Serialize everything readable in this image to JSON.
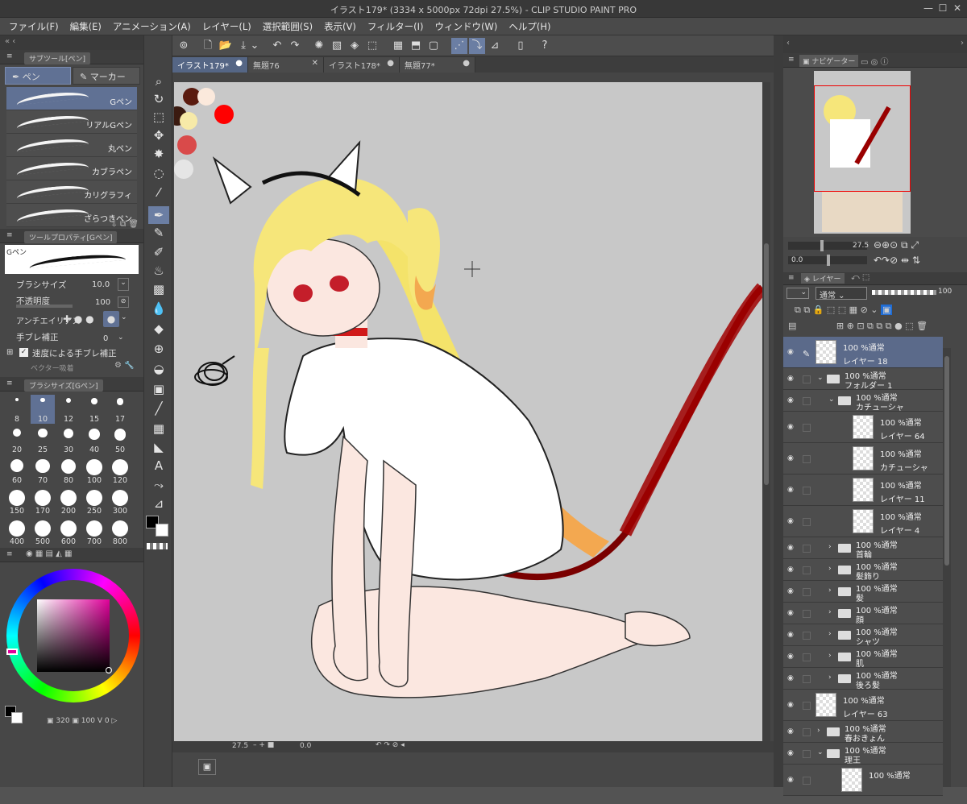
{
  "window": {
    "title": "イラスト179* (3334 x 5000px 72dpi 27.5%)  - CLIP STUDIO PAINT PRO"
  },
  "menu": [
    "ファイル(F)",
    "編集(E)",
    "アニメーション(A)",
    "レイヤー(L)",
    "選択範囲(S)",
    "表示(V)",
    "フィルター(I)",
    "ウィンドウ(W)",
    "ヘルプ(H)"
  ],
  "subtool": {
    "panel_label": "サブツール[ペン]",
    "groups": [
      "ペン",
      "マーカー"
    ],
    "brushes": [
      "Gペン",
      "リアルGペン",
      "丸ペン",
      "カブラペン",
      "カリグラフィ",
      "ざらつきペン"
    ]
  },
  "toolprop": {
    "panel_label": "ツールプロパティ[Gペン]",
    "preview_name": "Gペン",
    "brush_size_label": "ブラシサイズ",
    "brush_size": "10.0",
    "opacity_label": "不透明度",
    "opacity": "100",
    "antialias_label": "アンチエイリアス",
    "stabilize_label": "手ブレ補正",
    "stabilize": "0",
    "speed_label": "速度による手ブレ補正",
    "vector_label": "ベクター吸着"
  },
  "brushsize": {
    "panel_label": "ブラシサイズ[Gペン]",
    "sizes": [
      "8",
      "10",
      "12",
      "15",
      "17",
      "20",
      "25",
      "30",
      "40",
      "50",
      "60",
      "70",
      "80",
      "100",
      "120",
      "150",
      "170",
      "200",
      "250",
      "300",
      "400",
      "500",
      "600",
      "700",
      "800"
    ]
  },
  "color": {
    "readout_a": "320",
    "readout_b": "100",
    "readout_c": "V",
    "readout_d": "0"
  },
  "tabs": [
    {
      "label": "イラスト179*",
      "active": true
    },
    {
      "label": "無題76",
      "active": false
    },
    {
      "label": "イラスト178*",
      "active": false
    },
    {
      "label": "無題77*",
      "active": false
    }
  ],
  "status": {
    "zoom": "27.5",
    "angle": "0.0"
  },
  "navigator": {
    "label": "ナビゲーター",
    "zoom": "27.5",
    "angle": "0.0"
  },
  "layers": {
    "tab_label": "レイヤー",
    "blend_mode": "通常",
    "opacity": "100",
    "rows": [
      {
        "top": "100 %通常",
        "name": "レイヤー 18",
        "kind": "layer",
        "depth": 0,
        "sel": true
      },
      {
        "top": "100 %通常",
        "name": "フォルダー 1",
        "kind": "folder-open",
        "depth": 0,
        "sel": false
      },
      {
        "top": "100 %通常",
        "name": "カチューシャ",
        "kind": "folder-open",
        "depth": 1,
        "sel": false
      },
      {
        "top": "100 %通常",
        "name": "レイヤー 64",
        "kind": "layer",
        "depth": 2,
        "sel": false
      },
      {
        "top": "100 %通常",
        "name": "カチューシャ",
        "kind": "layer",
        "depth": 2,
        "sel": false
      },
      {
        "top": "100 %通常",
        "name": "レイヤー 11",
        "kind": "layer",
        "depth": 2,
        "sel": false
      },
      {
        "top": "100 %通常",
        "name": "レイヤー 4",
        "kind": "layer",
        "depth": 2,
        "sel": false
      },
      {
        "top": "100 %通常",
        "name": "首輪",
        "kind": "folder",
        "depth": 1,
        "sel": false
      },
      {
        "top": "100 %通常",
        "name": "髪飾り",
        "kind": "folder",
        "depth": 1,
        "sel": false
      },
      {
        "top": "100 %通常",
        "name": "髪",
        "kind": "folder",
        "depth": 1,
        "sel": false
      },
      {
        "top": "100 %通常",
        "name": "顔",
        "kind": "folder",
        "depth": 1,
        "sel": false
      },
      {
        "top": "100 %通常",
        "name": "シャツ",
        "kind": "folder",
        "depth": 1,
        "sel": false
      },
      {
        "top": "100 %通常",
        "name": "肌",
        "kind": "folder",
        "depth": 1,
        "sel": false
      },
      {
        "top": "100 %通常",
        "name": "後ろ髪",
        "kind": "folder",
        "depth": 1,
        "sel": false
      },
      {
        "top": "100 %通常",
        "name": "レイヤー 63",
        "kind": "layer",
        "depth": 0,
        "sel": false
      },
      {
        "top": "100 %通常",
        "name": "春おきょん",
        "kind": "folder",
        "depth": 0,
        "sel": false
      },
      {
        "top": "100 %通常",
        "name": "理王",
        "kind": "folder-open",
        "depth": 0,
        "sel": false
      },
      {
        "top": "100 %通常",
        "name": "",
        "kind": "layer",
        "depth": 1,
        "sel": false
      }
    ]
  },
  "palette_colors": [
    "#5a1a0e",
    "#fbe9dc",
    "#3a1a10",
    "#f7eaa8",
    "#ff0000",
    "#d94a4a",
    "#e5e5e5"
  ],
  "accent": "#6b7ea3"
}
